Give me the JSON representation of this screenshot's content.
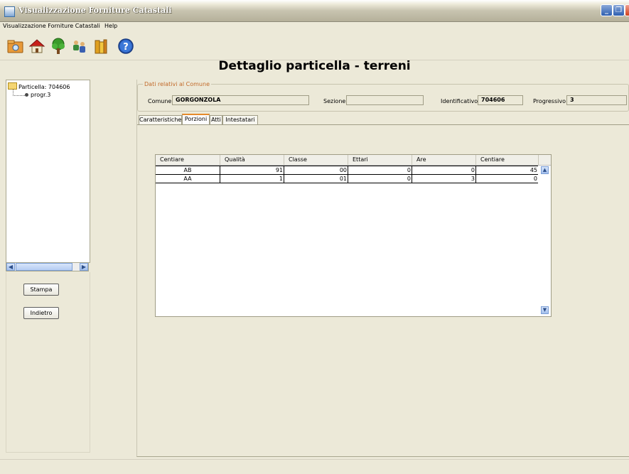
{
  "window": {
    "title": "Visualizzazione Forniture Catastali"
  },
  "menu": {
    "items": [
      "Visualizzazione Forniture Catastali",
      "Help"
    ]
  },
  "toolbar": {
    "icons": [
      "open-folder-icon",
      "house-icon",
      "tree-icon",
      "people-icon",
      "books-icon",
      "help-icon"
    ]
  },
  "page": {
    "title": "Dettaglio particella - terreni"
  },
  "tree": {
    "root_label": "Particella: 704606",
    "child_label": "progr.3"
  },
  "buttons": {
    "stampa": "Stampa",
    "indietro": "Indietro"
  },
  "comune_group": {
    "legend": "Dati relativi al Comune",
    "comune_label": "Comune",
    "comune_value": "GORGONZOLA",
    "sezione_label": "Sezione",
    "sezione_value": "",
    "identificativo_label": "Identificativo",
    "identificativo_value": "704606",
    "progressivo_label": "Progressivo",
    "progressivo_value": "3"
  },
  "tabs": [
    "Caratteristiche",
    "Porzioni",
    "Atti",
    "Intestatari"
  ],
  "active_tab": "Porzioni",
  "table": {
    "headers": [
      "Centiare",
      "Qualità",
      "Classe",
      "Ettari",
      "Are",
      "Centiare"
    ],
    "rows": [
      [
        "AB",
        "91",
        "00",
        "0",
        "0",
        "45"
      ],
      [
        "AA",
        "1",
        "01",
        "0",
        "3",
        "0"
      ]
    ]
  },
  "colors": {
    "accent": "#e68b2c",
    "legend": "#c26a2a",
    "background": "#ece9d8"
  }
}
